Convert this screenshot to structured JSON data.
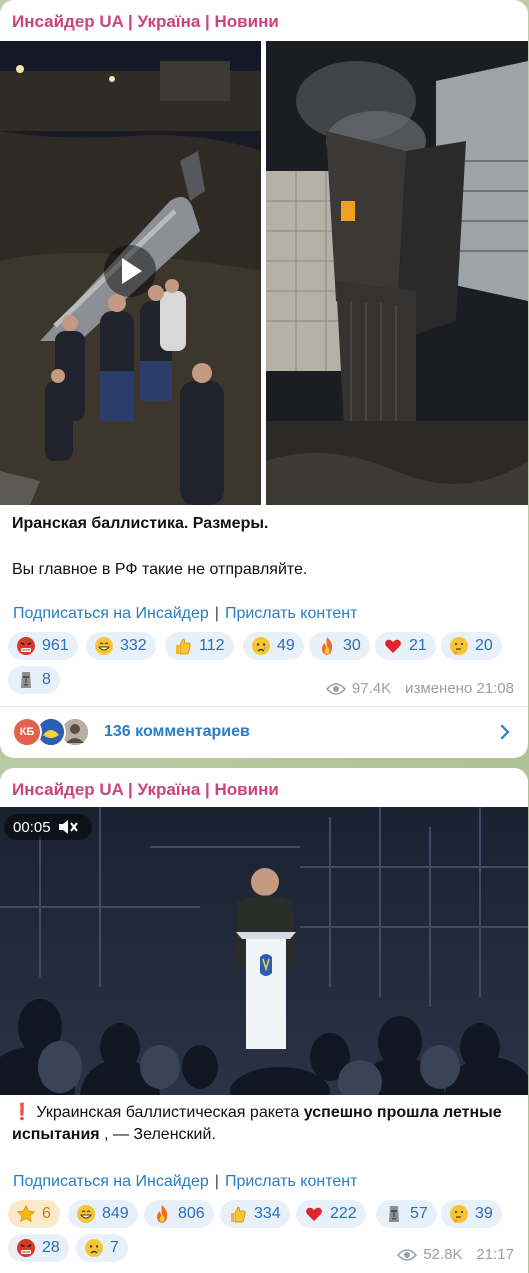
{
  "posts": [
    {
      "channel": "Инсайдер UA | Україна | Новини",
      "title": "Иранская баллистика. Размеры.",
      "text": "Вы главное в РФ такие не отправляйте.",
      "link_subscribe": "Подписаться на Инсайдер",
      "link_separator": "|",
      "link_send": "Прислать контент",
      "reactions": [
        {
          "icon": "angry-face-icon",
          "count": "961"
        },
        {
          "icon": "grinning-face-icon",
          "count": "332"
        },
        {
          "icon": "thumbs-up-icon",
          "count": "112"
        },
        {
          "icon": "crying-face-icon",
          "count": "49"
        },
        {
          "icon": "fire-icon",
          "count": "30"
        },
        {
          "icon": "heart-icon",
          "count": "21"
        },
        {
          "icon": "thinking-face-icon",
          "count": "20"
        },
        {
          "icon": "moai-icon",
          "count": "8"
        }
      ],
      "views": "97.4K",
      "edited_time": "изменено 21:08",
      "comments": "136 комментариев",
      "commenter_avatar_initials": "КБ"
    },
    {
      "channel": "Инсайдер UA | Україна | Новини",
      "video_duration": "00:05",
      "text_lead": "Украинская баллистическая ракета ",
      "text_bold": "успешно прошла летные испытания",
      "text_tail": " , — Зеленский.",
      "link_subscribe": "Подписаться на Инсайдер",
      "link_separator": "|",
      "link_send": "Прислать контент",
      "reactions": [
        {
          "icon": "star-icon",
          "count": "6"
        },
        {
          "icon": "grinning-face-icon",
          "count": "849"
        },
        {
          "icon": "fire-icon",
          "count": "806"
        },
        {
          "icon": "thumbs-up-icon",
          "count": "334"
        },
        {
          "icon": "heart-icon",
          "count": "222"
        },
        {
          "icon": "moai-icon",
          "count": "57"
        },
        {
          "icon": "thinking-face-icon",
          "count": "39"
        },
        {
          "icon": "angry-face-icon",
          "count": "28"
        },
        {
          "icon": "crying-face-icon",
          "count": "7"
        }
      ],
      "views": "52.8K",
      "time": "21:17"
    }
  ]
}
